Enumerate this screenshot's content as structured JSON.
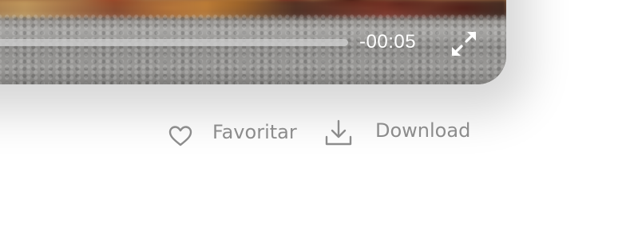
{
  "player": {
    "time_remaining": "-00:05",
    "progress_fraction": 0.98
  },
  "actions": {
    "favorite_label": "Favoritar",
    "download_label": "Download"
  },
  "icons": {
    "favorite": "heart-outline-icon",
    "download": "download-tray-icon",
    "fullscreen": "expand-arrows-icon"
  },
  "colors": {
    "label_gray": "#8c8c8c",
    "player_text": "#ffffff"
  }
}
